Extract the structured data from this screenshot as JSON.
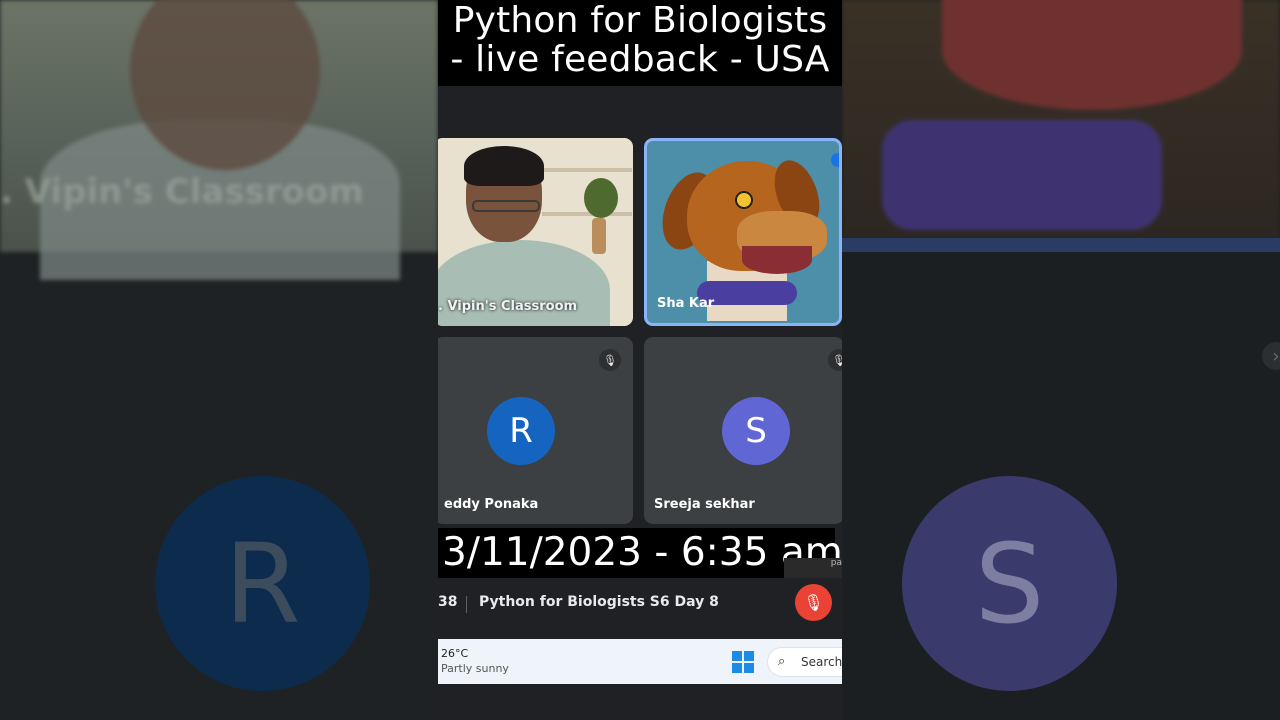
{
  "video": {
    "title_line1": "Python for Biologists",
    "title_line2": "- live feedback - USA",
    "date_overlay": "3/11/2023 - 6:35 am"
  },
  "backdrop": {
    "left_caption": ". Vipin's Classroom",
    "avatar_r": "R",
    "avatar_s": "S",
    "chevron": "›"
  },
  "participants": [
    {
      "name": ". Vipin's Classroom",
      "type": "video"
    },
    {
      "name": "Sha Kar",
      "type": "avatar-dog",
      "active_speaker": true
    },
    {
      "name": "eddy Ponaka",
      "initial": "R",
      "avatar_color": "#1565c0",
      "muted": true
    },
    {
      "name": "Sreeja sekhar",
      "initial": "S",
      "avatar_color": "#6067d4",
      "muted": true
    }
  ],
  "meeting": {
    "time": "38",
    "title": "Python for Biologists S6 Day 8",
    "mic_state": "muted",
    "corner_chip": "pa"
  },
  "taskbar": {
    "temperature": "26°C",
    "weather": "Partly sunny",
    "search_label": "Search",
    "start_icon": "windows-logo-icon"
  },
  "icons": {
    "mic_off": "🎙",
    "search": "⌕"
  },
  "colors": {
    "active_border": "#8ab4f8",
    "mic_red": "#ea4335",
    "meet_bg": "#202124"
  }
}
